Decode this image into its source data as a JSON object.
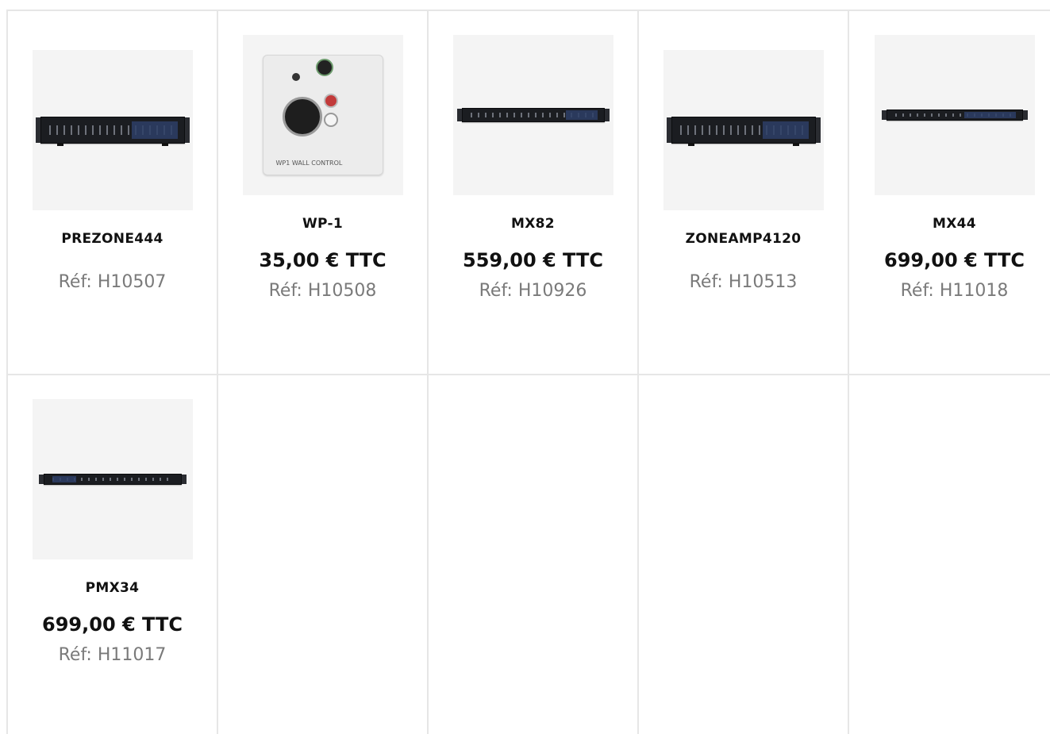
{
  "products": [
    {
      "name": "PREZONE444",
      "price": "",
      "ref": "Réf: H10507",
      "image": "rack-mixer-2u"
    },
    {
      "name": "WP-1",
      "price": "35,00 € TTC",
      "ref": "Réf: H10508",
      "image": "wall-plate",
      "plate_label": "WP1 WALL CONTROL"
    },
    {
      "name": "MX82",
      "price": "559,00 € TTC",
      "ref": "Réf: H10926",
      "image": "rack-mixer-1u"
    },
    {
      "name": "ZONEAMP4120",
      "price": "",
      "ref": "Réf: H10513",
      "image": "rack-mixer-2u"
    },
    {
      "name": "MX44",
      "price": "699,00 € TTC",
      "ref": "Réf: H11018",
      "image": "rack-mixer-1u-slim"
    },
    {
      "name": "PMX34",
      "price": "699,00 € TTC",
      "ref": "Réf: H11017",
      "image": "rack-mixer-1u-slim"
    }
  ]
}
